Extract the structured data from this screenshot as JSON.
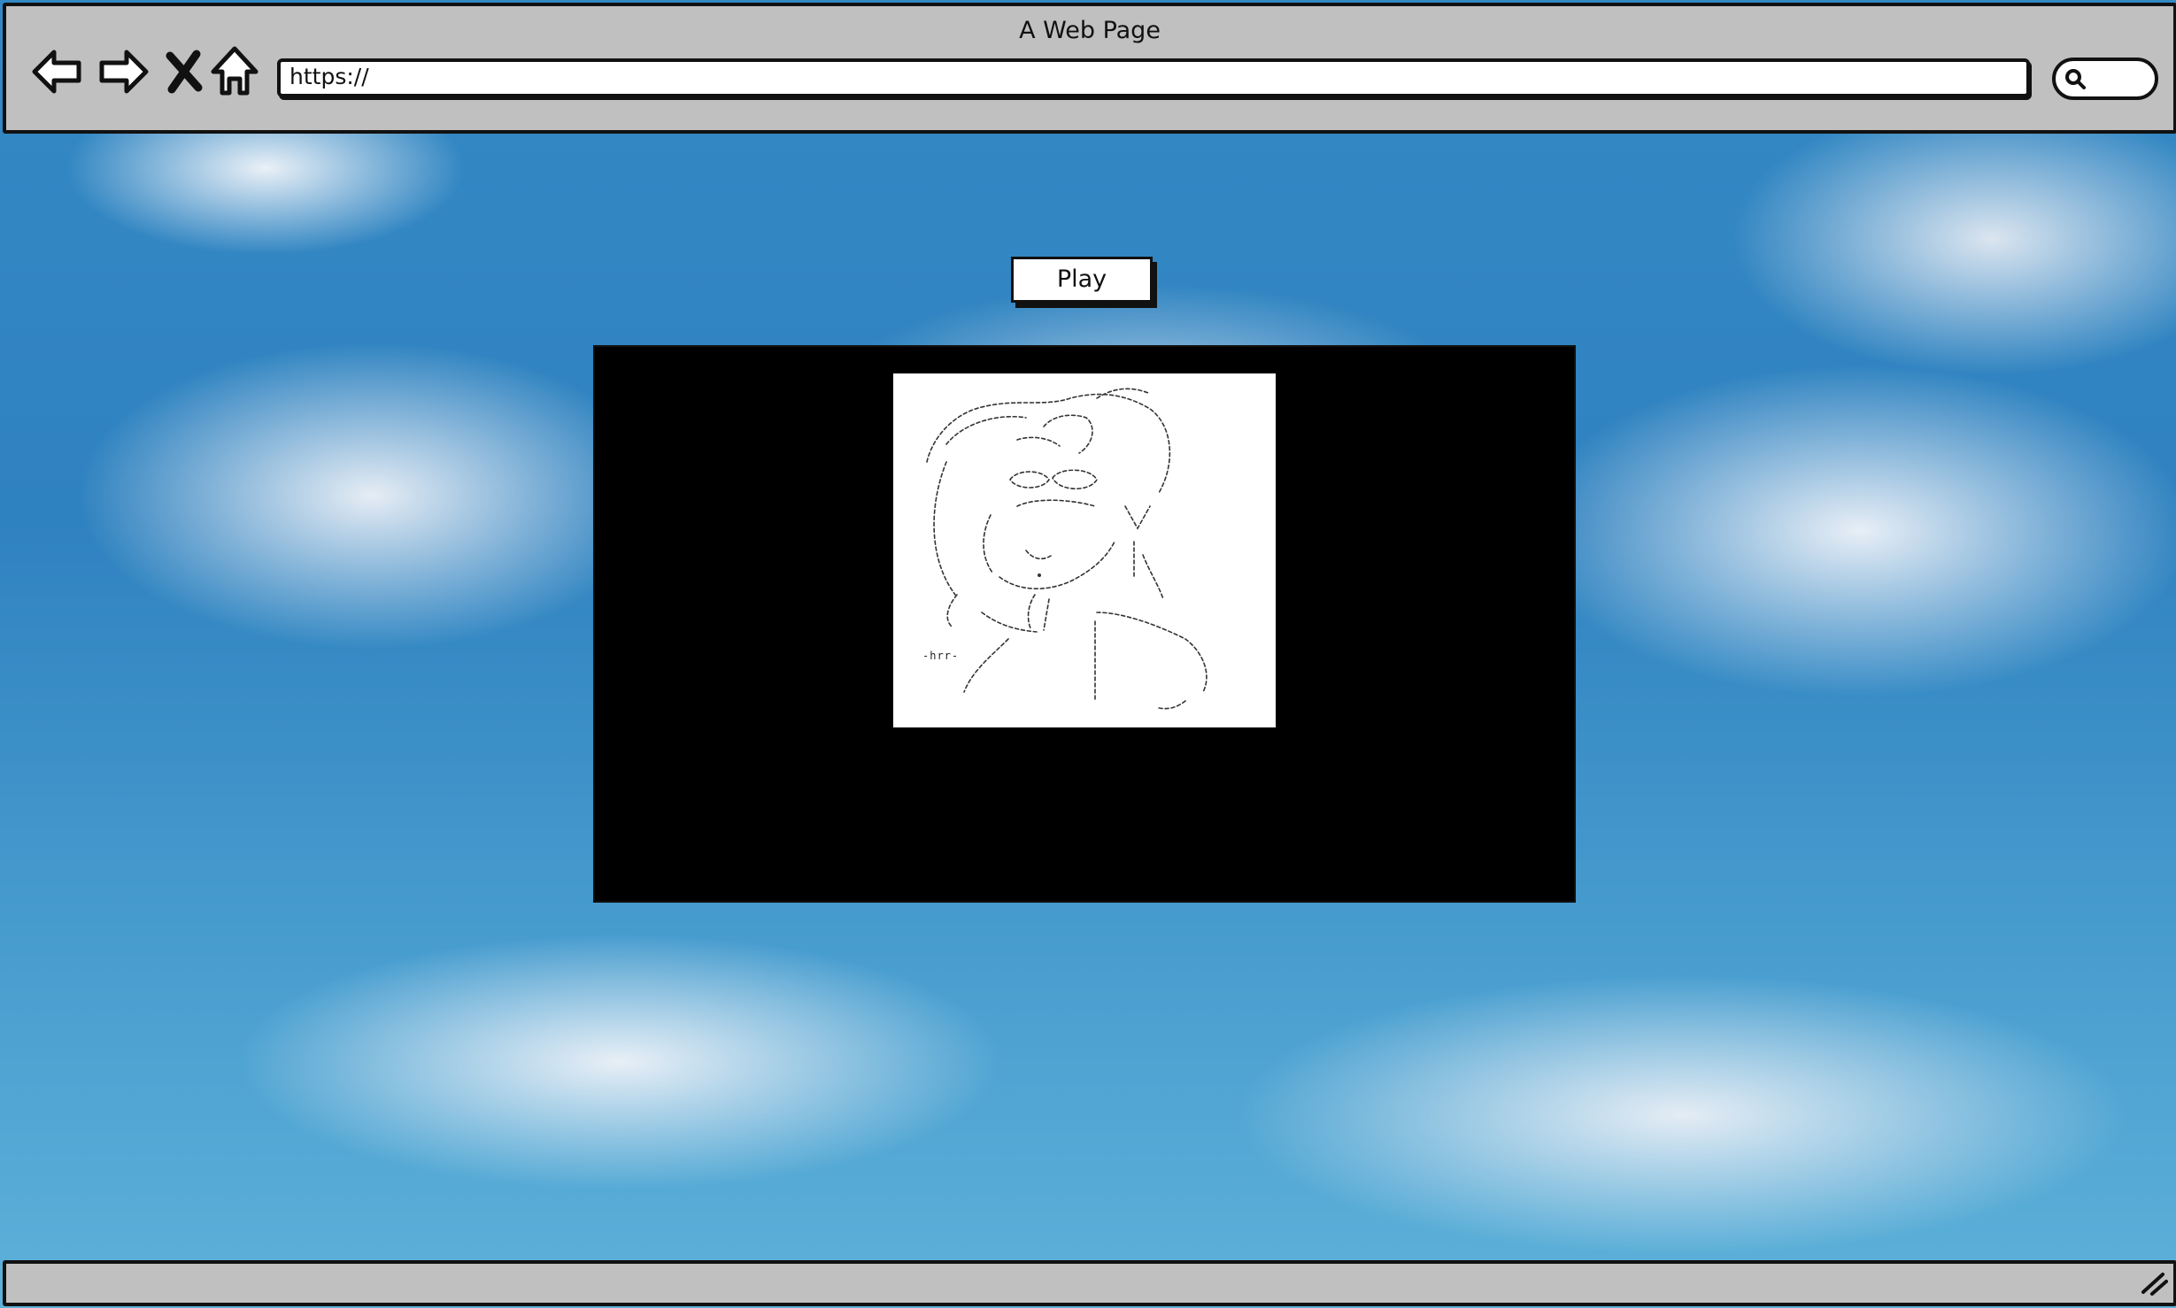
{
  "window": {
    "title": "A Web Page"
  },
  "toolbar": {
    "back_icon": "back-arrow-icon",
    "forward_icon": "forward-arrow-icon",
    "stop_icon": "close-x-icon",
    "home_icon": "home-icon",
    "address_value": "https://",
    "search_icon": "search-icon"
  },
  "content": {
    "play_label": "Play",
    "thumbnail_signature": "-hrr-"
  },
  "status_bar": {
    "resize_icon": "resize-grip-icon"
  },
  "colors": {
    "chrome": "#c0c0c0",
    "outline": "#111111",
    "sky": "#2f82c0",
    "player": "#000000"
  }
}
